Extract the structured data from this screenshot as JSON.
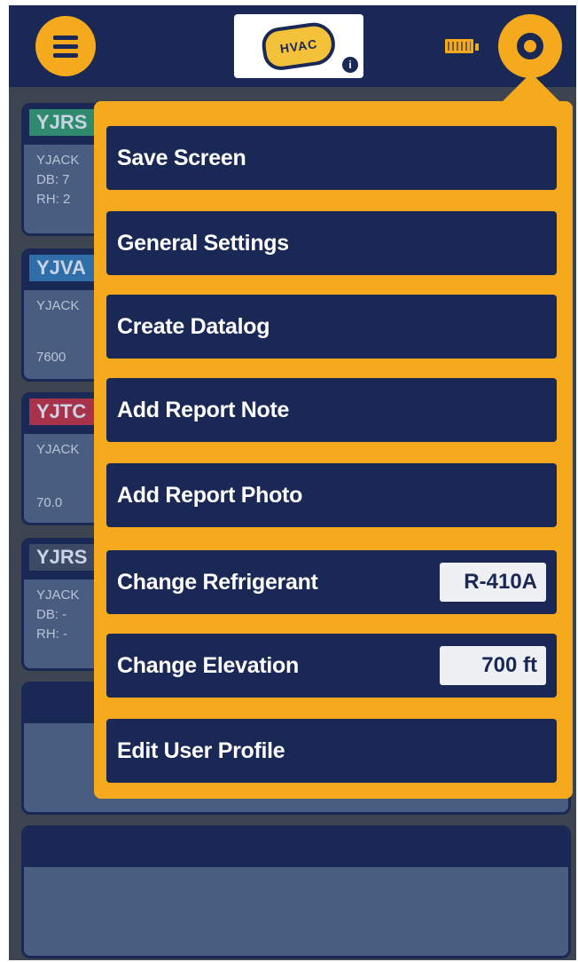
{
  "header": {
    "logo_text": "HVAC",
    "logo_info_icon": "i"
  },
  "background_cards": [
    {
      "tag": "YJRS",
      "tag_color": "#2f8a6e",
      "lines": [
        "YJACK",
        "DB: 7",
        "RH: 2"
      ]
    },
    {
      "tag": "YJVA",
      "tag_color": "#2f6ea8",
      "lines": [
        "YJACK",
        "",
        "7600"
      ]
    },
    {
      "tag": "YJTC",
      "tag_color": "#a8324a",
      "lines": [
        "YJACK",
        "",
        "70.0"
      ]
    },
    {
      "tag": "YJRS",
      "tag_color": "#3c4a66",
      "lines": [
        "YJACK",
        "DB: -",
        "RH: -"
      ]
    }
  ],
  "menu": {
    "items": [
      {
        "label": "Save Screen",
        "value": null
      },
      {
        "label": "General Settings",
        "value": null
      },
      {
        "label": "Create Datalog",
        "value": null
      },
      {
        "label": "Add Report Note",
        "value": null
      },
      {
        "label": "Add Report Photo",
        "value": null
      },
      {
        "label": "Change Refrigerant",
        "value": "R-410A"
      },
      {
        "label": "Change Elevation",
        "value": "700 ft"
      },
      {
        "label": "Edit User Profile",
        "value": null
      }
    ]
  },
  "colors": {
    "accent": "#f4aa1c",
    "navy": "#1a2855",
    "card": "#495d80"
  }
}
